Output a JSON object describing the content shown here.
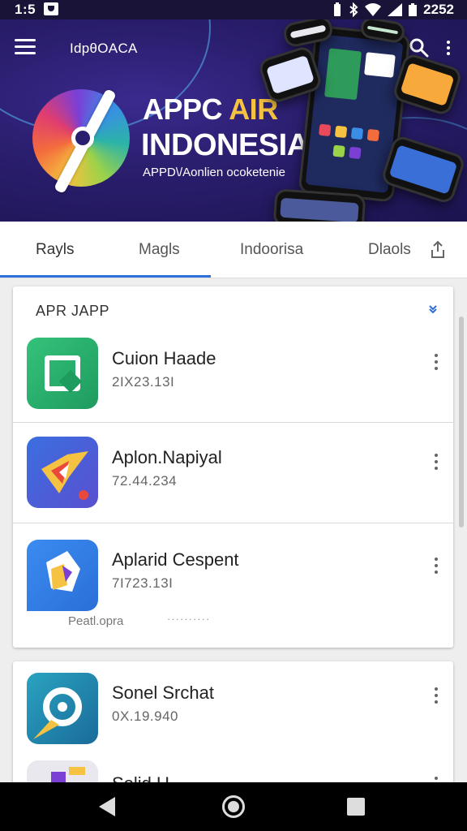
{
  "status_bar": {
    "time": "1:5",
    "clock": "2252"
  },
  "app_bar": {
    "title": "IdpθOACA"
  },
  "banner": {
    "line1_main": "APPC ",
    "line1_accent": "AIR",
    "line2": "INDONESIA",
    "subtitle": "APPD\\/Aonlien ocoketenie"
  },
  "tabs": [
    {
      "label": "Rayls",
      "active": true
    },
    {
      "label": "Magls",
      "active": false
    },
    {
      "label": "Indoorisa",
      "active": false
    },
    {
      "label": "Dlaols",
      "active": false
    }
  ],
  "section": {
    "title": "APR JAPP"
  },
  "apps": [
    {
      "name": "Cuion Haade",
      "meta": "2IX23.13I"
    },
    {
      "name": "Aplon.Napiyal",
      "meta": "72.44.234"
    },
    {
      "name": "Aplarid Cespent",
      "meta": "7I723.13I",
      "caption": "Peatl.opra",
      "caption_dots": "··········"
    },
    {
      "name": "Sonel Srchat",
      "meta": "0X.19.940"
    },
    {
      "name": "Solid U..."
    }
  ],
  "colors": {
    "tab_indicator": "#2f6fd8",
    "banner_bg": "#2a1e6e",
    "accent_yellow": "#f5c242"
  },
  "icons": [
    "menu-icon",
    "search-icon",
    "more-vert-icon",
    "chevron-down-icon",
    "share-icon",
    "back-icon",
    "home-icon",
    "recents-icon"
  ]
}
